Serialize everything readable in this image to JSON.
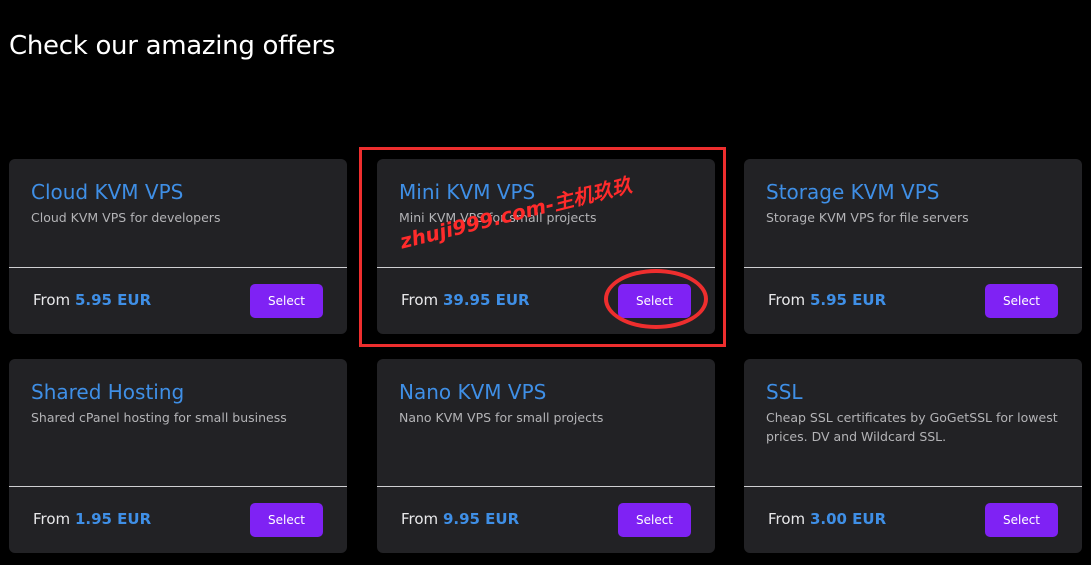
{
  "header": {
    "title": "Check our amazing offers"
  },
  "offers": [
    {
      "title": "Cloud KVM VPS",
      "description": "Cloud KVM VPS for developers",
      "price_prefix": "From",
      "price": "5.95 EUR",
      "button_label": "Select"
    },
    {
      "title": "Mini KVM VPS",
      "description": "Mini KVM VPS for small projects",
      "price_prefix": "From",
      "price": "39.95 EUR",
      "button_label": "Select"
    },
    {
      "title": "Storage KVM VPS",
      "description": "Storage KVM VPS for file servers",
      "price_prefix": "From",
      "price": "5.95 EUR",
      "button_label": "Select"
    },
    {
      "title": "Shared Hosting",
      "description": "Shared cPanel hosting for small business",
      "price_prefix": "From",
      "price": "1.95 EUR",
      "button_label": "Select"
    },
    {
      "title": "Nano KVM VPS",
      "description": "Nano KVM VPS for small projects",
      "price_prefix": "From",
      "price": "9.95 EUR",
      "button_label": "Select"
    },
    {
      "title": "SSL",
      "description": "Cheap SSL certificates by GoGetSSL for lowest prices. DV and Wildcard SSL.",
      "price_prefix": "From",
      "price": "3.00 EUR",
      "button_label": "Select"
    }
  ],
  "annotation": {
    "watermark": "zhuji999.com-主机玖玖"
  },
  "colors": {
    "background": "#000000",
    "card": "#222225",
    "accent_blue": "#3f8fe6",
    "button_purple": "#7f22f4",
    "highlight_red": "#ee2e2e"
  }
}
